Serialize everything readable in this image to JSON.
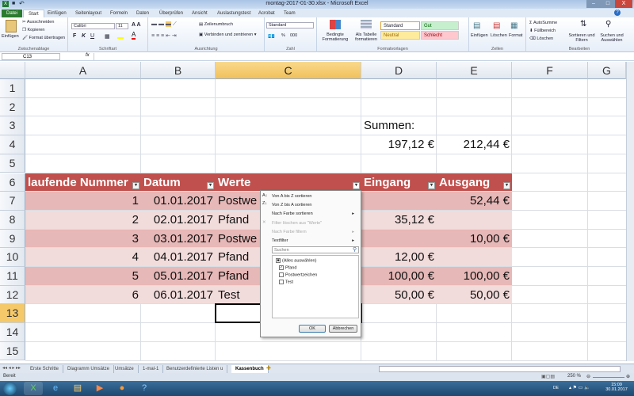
{
  "window": {
    "title": "montag-2017-01-30.xlsx - Microsoft Excel",
    "min": "–",
    "max": "□",
    "close": "X"
  },
  "tabs": [
    "Datei",
    "Start",
    "Einfügen",
    "Seitenlayout",
    "Formeln",
    "Daten",
    "Überprüfen",
    "Ansicht",
    "Auslastungstest",
    "Acrobat",
    "Team"
  ],
  "ribbon": {
    "clipboard": {
      "paste": "Einfügen",
      "cut": "Ausschneiden",
      "copy": "Kopieren",
      "format": "Format übertragen",
      "label": "Zwischenablage"
    },
    "font": {
      "name": "Calibri",
      "size": "11",
      "bold": "F",
      "italic": "K",
      "underline": "U",
      "label": "Schriftart"
    },
    "align": {
      "wrap": "Zeilenumbruch",
      "merge": "Verbinden und zentrieren",
      "label": "Ausrichtung"
    },
    "number": {
      "format": "Standard",
      "percent": "%",
      "thousands": "000",
      "label": "Zahl"
    },
    "styles": {
      "cond": "Bedingte Formatierung",
      "table": "Als Tabelle formatieren",
      "standard": "Standard",
      "gut": "Gut",
      "neutral": "Neutral",
      "schlecht": "Schlecht",
      "label": "Formatvorlagen"
    },
    "cells": {
      "insert": "Einfügen",
      "delete": "Löschen",
      "format": "Format",
      "label": "Zellen"
    },
    "edit": {
      "autosum": "AutoSumme",
      "fill": "Füllbereich",
      "clear": "Löschen",
      "sort": "Sortieren und Filtern",
      "find": "Suchen und Auswählen",
      "label": "Bearbeiten"
    }
  },
  "formula_bar": {
    "name_box": "C13",
    "fx": "fx",
    "value": ""
  },
  "columns": [
    "A",
    "B",
    "C",
    "D",
    "E",
    "F",
    "G"
  ],
  "rows": [
    "1",
    "2",
    "3",
    "4",
    "5",
    "6",
    "7",
    "8",
    "9",
    "10",
    "11",
    "12",
    "13",
    "14",
    "15"
  ],
  "summary": {
    "label": "Summen:",
    "eingang": "197,12 €",
    "ausgang": "212,44 €"
  },
  "table": {
    "headers": [
      "laufende Nummer",
      "Datum",
      "Werte",
      "Eingang",
      "Ausgang"
    ],
    "rows": [
      [
        "1",
        "01.01.2017",
        "Postwe",
        "",
        "52,44 €"
      ],
      [
        "2",
        "02.01.2017",
        "Pfand",
        "35,12 €",
        ""
      ],
      [
        "3",
        "03.01.2017",
        "Postwe",
        "",
        "10,00 €"
      ],
      [
        "4",
        "04.01.2017",
        "Pfand",
        "12,00 €",
        ""
      ],
      [
        "5",
        "05.01.2017",
        "Pfand",
        "100,00 €",
        "100,00 €"
      ],
      [
        "6",
        "06.01.2017",
        "Test",
        "50,00 €",
        "50,00 €"
      ]
    ]
  },
  "filter_menu": {
    "sort_az": "Von A bis Z sortieren",
    "sort_za": "Von Z bis A sortieren",
    "sort_color": "Nach Farbe sortieren",
    "clear": "Filter löschen aus \"Werte\"",
    "filter_color": "Nach Farbe filtern",
    "textfilter": "Textfilter",
    "search_placeholder": "Suchen",
    "items": [
      {
        "label": "(Alles auswählen)",
        "state": "partial"
      },
      {
        "label": "Pfand",
        "state": "checked"
      },
      {
        "label": "Postwertzeichen",
        "state": "unchecked"
      },
      {
        "label": "Test",
        "state": "unchecked"
      }
    ],
    "ok": "OK",
    "cancel": "Abbrechen"
  },
  "sheets": [
    "Erste Schritte",
    "Diagramm Umsätze",
    "Umsätze",
    "1-mal-1",
    "Benutzerdefinierte Listen u",
    "Kassenbuch"
  ],
  "active_sheet": "Kassenbuch",
  "status": {
    "ready": "Bereit",
    "zoom": "250 %"
  },
  "clock": {
    "time": "15:09",
    "date": "30.01.2017",
    "lang": "DE"
  }
}
